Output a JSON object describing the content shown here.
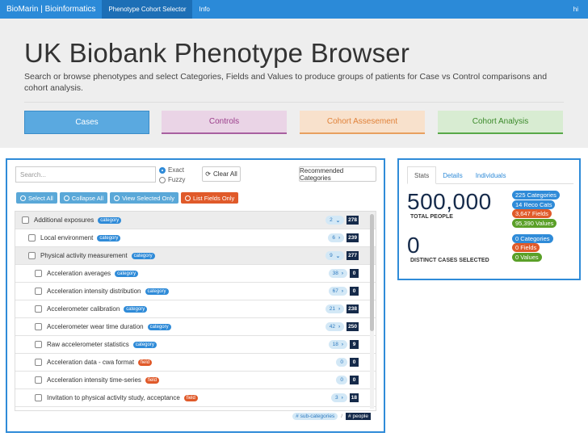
{
  "nav": {
    "brand": "BioMarin | Bioinformatics",
    "items": [
      "Phenotype Cohort Selector",
      "Info"
    ],
    "user": "hi"
  },
  "hero": {
    "title": "UK Biobank Phenotype Browser",
    "description": "Search or browse phenotypes and select Categories, Fields and Values to produce groups of patients for Case vs Control comparisons and cohort analysis.",
    "tabs": [
      "Cases",
      "Controls",
      "Cohort Assesement",
      "Cohort Analysis"
    ]
  },
  "browser": {
    "search_placeholder": "Search...",
    "radio_exact": "Exact",
    "radio_fuzzy": "Fuzzy",
    "clear_all": "Clear All",
    "recommended": "Recommended Categories",
    "actions": [
      "Select All",
      "Collapse All",
      "View Selected Only",
      "List Fields Only"
    ],
    "rows": [
      {
        "label": "Additional exposures",
        "type": "category",
        "sub": "2",
        "people": "278",
        "level": 0,
        "shaded": true,
        "arrow": "v"
      },
      {
        "label": "Local environment",
        "type": "category",
        "sub": "6",
        "people": "239",
        "level": 1,
        "shaded": false,
        "arrow": ">"
      },
      {
        "label": "Physical activity measurement",
        "type": "category",
        "sub": "9",
        "people": "277",
        "level": 1,
        "shaded": true,
        "arrow": "v"
      },
      {
        "label": "Acceleration averages",
        "type": "category",
        "sub": "38",
        "people": "0",
        "level": 2,
        "shaded": false,
        "arrow": ">"
      },
      {
        "label": "Acceleration intensity distribution",
        "type": "category",
        "sub": "67",
        "people": "0",
        "level": 2,
        "shaded": false,
        "arrow": ">"
      },
      {
        "label": "Accelerometer calibration",
        "type": "category",
        "sub": "21",
        "people": "238",
        "level": 2,
        "shaded": false,
        "arrow": ">"
      },
      {
        "label": "Accelerometer wear time duration",
        "type": "category",
        "sub": "42",
        "people": "250",
        "level": 2,
        "shaded": false,
        "arrow": ">"
      },
      {
        "label": "Raw accelerometer statistics",
        "type": "category",
        "sub": "18",
        "people": "9",
        "level": 2,
        "shaded": false,
        "arrow": ">"
      },
      {
        "label": "Acceleration data - cwa format",
        "type": "field",
        "sub": "0",
        "people": "0",
        "level": 2,
        "shaded": false,
        "arrow": ""
      },
      {
        "label": "Acceleration intensity time-series",
        "type": "field",
        "sub": "0",
        "people": "0",
        "level": 2,
        "shaded": false,
        "arrow": ""
      },
      {
        "label": "Invitation to physical activity study, acceptance",
        "type": "field",
        "sub": "3",
        "people": "18",
        "level": 2,
        "shaded": false,
        "arrow": ">"
      }
    ],
    "legend_sub": "# sub-categories",
    "legend_sep": "/",
    "legend_people": "# people"
  },
  "stats": {
    "tabs": [
      "Stats",
      "Details",
      "Individuals"
    ],
    "total": "500,000",
    "total_label": "TOTAL PEOPLE",
    "total_badges": [
      "225 Categories",
      "14 Reco Cats",
      "3,647 Fields",
      "95,390 Values"
    ],
    "distinct": "0",
    "distinct_label": "DISTINCT CASES SELECTED",
    "distinct_badges": [
      "0 Categories",
      "0 Fields",
      "0 Values"
    ]
  }
}
